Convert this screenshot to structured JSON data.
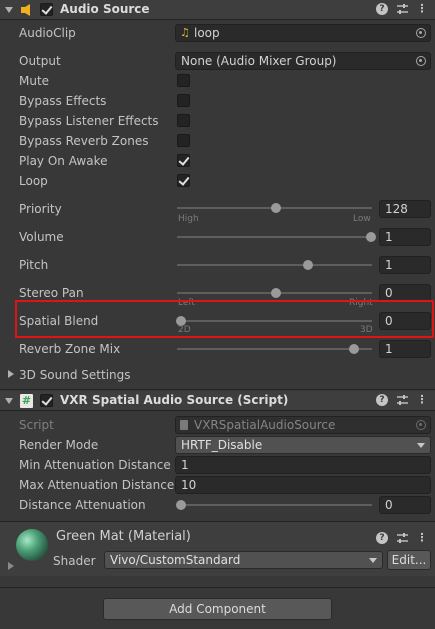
{
  "audio_source": {
    "title": "Audio Source",
    "enabled": true,
    "audio_clip": {
      "label": "AudioClip",
      "value": "loop"
    },
    "output": {
      "label": "Output",
      "value": "None (Audio Mixer Group)"
    },
    "toggles": [
      {
        "label": "Mute",
        "checked": false
      },
      {
        "label": "Bypass Effects",
        "checked": false
      },
      {
        "label": "Bypass Listener Effects",
        "checked": false
      },
      {
        "label": "Bypass Reverb Zones",
        "checked": false
      },
      {
        "label": "Play On Awake",
        "checked": true
      },
      {
        "label": "Loop",
        "checked": true
      }
    ],
    "priority": {
      "label": "Priority",
      "value": "128",
      "min_label": "High",
      "max_label": "Low",
      "fraction": 0.5
    },
    "volume": {
      "label": "Volume",
      "value": "1",
      "fraction": 1.0
    },
    "pitch": {
      "label": "Pitch",
      "value": "1",
      "fraction": 0.667
    },
    "stereo_pan": {
      "label": "Stereo Pan",
      "value": "0",
      "min_label": "Left",
      "max_label": "Right",
      "fraction": 0.5
    },
    "spatial_blend": {
      "label": "Spatial Blend",
      "value": "0",
      "min_label": "2D",
      "max_label": "3D",
      "fraction": 0.0
    },
    "reverb_zone_mix": {
      "label": "Reverb Zone Mix",
      "value": "1",
      "fraction": 0.9
    },
    "sound_settings_label": "3D Sound Settings"
  },
  "vxr_script": {
    "title": "VXR Spatial Audio Source (Script)",
    "enabled": true,
    "script": {
      "label": "Script",
      "value": "VXRSpatialAudioSource"
    },
    "render_mode": {
      "label": "Render Mode",
      "value": "HRTF_Disable"
    },
    "min_attenuation": {
      "label": "Min Attenuation Distance",
      "value": "1"
    },
    "max_attenuation": {
      "label": "Max Attenuation Distance",
      "value": "10"
    },
    "distance_attenuation": {
      "label": "Distance Attenuation",
      "value": "0",
      "fraction": 0.0
    }
  },
  "material": {
    "title": "Green Mat (Material)",
    "shader_label": "Shader",
    "shader_value": "Vivo/CustomStandard",
    "edit_label": "Edit..."
  },
  "add_component_label": "Add Component",
  "colors": {
    "highlight_box": "#e01414",
    "speaker_icon": "#f0b020",
    "script_icon": "#3fa34d"
  }
}
